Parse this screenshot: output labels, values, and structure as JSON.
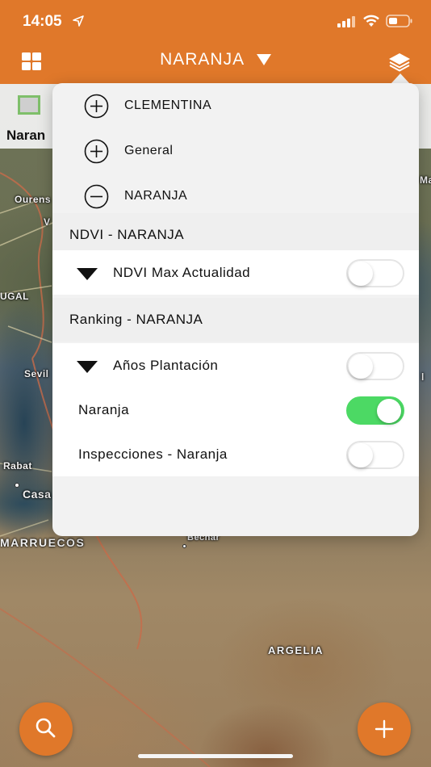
{
  "status_bar": {
    "time": "14:05"
  },
  "header": {
    "title": "NARANJA",
    "grid_icon": "grid-icon",
    "layers_icon": "layers-icon",
    "caret_icon": "caret-down-icon",
    "background_color": "#e0782a"
  },
  "underlay": {
    "label": "Naran"
  },
  "map": {
    "labels": [
      {
        "text": "Ourens"
      },
      {
        "text": "V"
      },
      {
        "text": "UGAL"
      },
      {
        "text": "Sevil"
      },
      {
        "text": "Rabat"
      },
      {
        "text": "Casa"
      },
      {
        "text": "MARRUECOS"
      },
      {
        "text": "Bechar"
      },
      {
        "text": "ARGELIA"
      },
      {
        "text": "Ma"
      },
      {
        "text": "l"
      }
    ]
  },
  "popover": {
    "groups": [
      {
        "label": "CLEMENTINA",
        "icon": "plus-circle-icon"
      },
      {
        "label": "General",
        "icon": "plus-circle-icon"
      },
      {
        "label": "NARANJA",
        "icon": "minus-circle-icon"
      }
    ],
    "sections": [
      {
        "title": "NDVI - NARANJA",
        "layers": [
          {
            "label": "NDVI Max Actualidad",
            "expandable": true,
            "enabled": false
          }
        ]
      },
      {
        "title": "Ranking - NARANJA",
        "layers": [
          {
            "label": "Años Plantación",
            "expandable": true,
            "enabled": false
          },
          {
            "label": "Naranja",
            "expandable": false,
            "enabled": true
          },
          {
            "label": "Inspecciones - Naranja",
            "expandable": false,
            "enabled": false
          }
        ]
      }
    ]
  },
  "buttons": {
    "search_icon": "search-icon",
    "add_icon": "plus-icon"
  },
  "colors": {
    "accent": "#e0782a",
    "toggle_on": "#4cd964"
  }
}
